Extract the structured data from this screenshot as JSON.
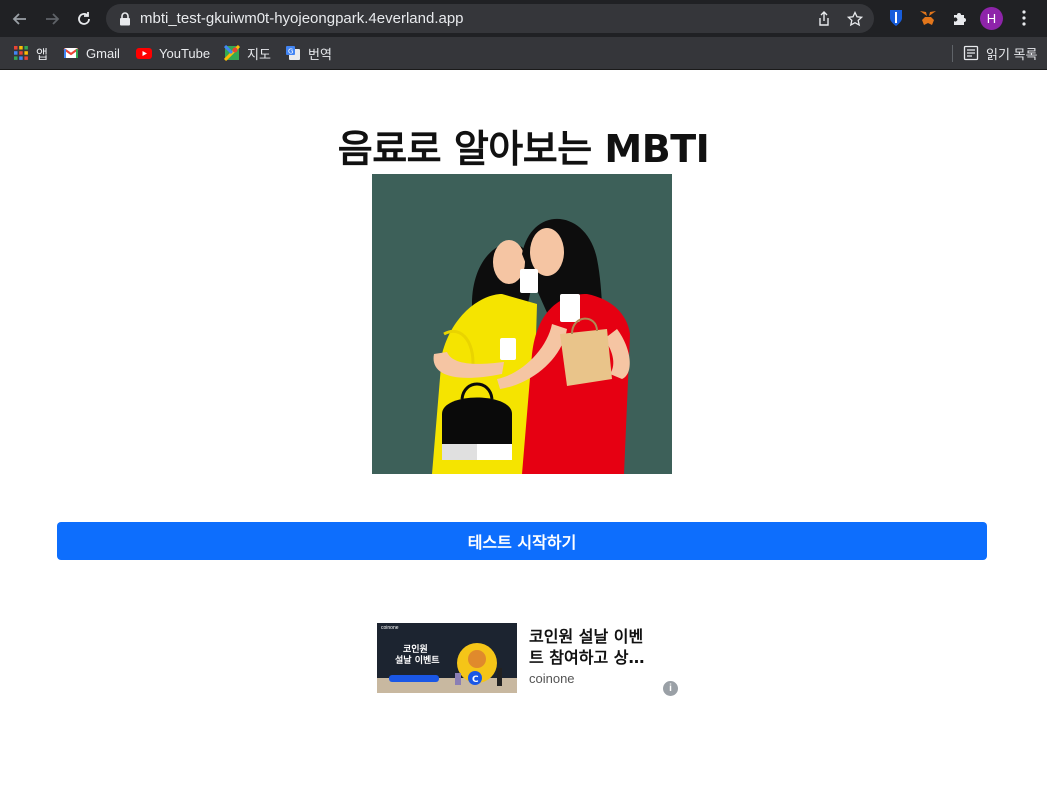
{
  "browser": {
    "url": "mbti_test-gkuiwm0t-hyojeongpark.4everland.app",
    "profile_initial": "H",
    "bookmarks": [
      {
        "label": "앱",
        "icon": "apps-grid-icon"
      },
      {
        "label": "Gmail",
        "icon": "gmail-icon"
      },
      {
        "label": "YouTube",
        "icon": "youtube-icon"
      },
      {
        "label": "지도",
        "icon": "maps-icon"
      },
      {
        "label": "번역",
        "icon": "translate-icon"
      }
    ],
    "reading_list_label": "읽기 목록"
  },
  "main": {
    "title": "음료로 알아보는 MBTI",
    "hero_image": "two-women-with-drinks-illustration",
    "start_button_label": "테스트 시작하기"
  },
  "ad": {
    "headline": "코인원 설날 이벤트 참여하고 상…",
    "source": "coinone",
    "info_icon": "info-icon",
    "thumb_text_1": "코인원",
    "thumb_text_2": "설날 이벤트",
    "thumb_brand": "coinone"
  },
  "colors": {
    "chrome_dark": "#202124",
    "bookmark_bar": "#35363a",
    "accent_button": "#0d6efd",
    "hero_bg": "#3d6059"
  }
}
